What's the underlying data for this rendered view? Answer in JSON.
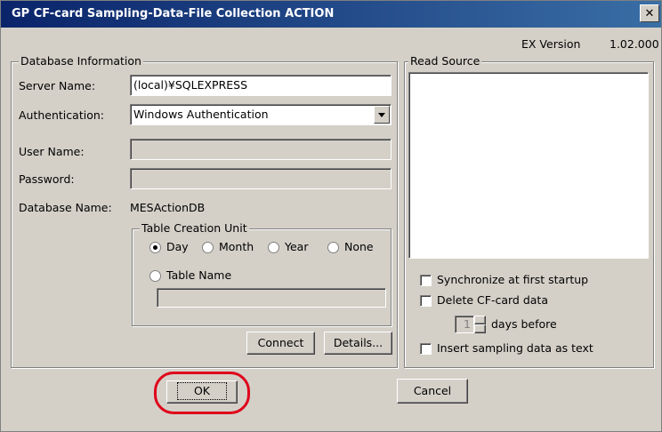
{
  "window": {
    "title": "GP CF-card Sampling-Data-File Collection ACTION",
    "close_label": "✕"
  },
  "version": {
    "label": "EX Version",
    "value": "1.02.000"
  },
  "db": {
    "legend": "Database Information",
    "server_label": "Server Name:",
    "server_value": "(local)¥SQLEXPRESS",
    "auth_label": "Authentication:",
    "auth_value": "Windows Authentication",
    "user_label": "User Name:",
    "user_value": "",
    "password_label": "Password:",
    "password_value": "",
    "dbname_label": "Database Name:",
    "dbname_value": "MESActionDB"
  },
  "table_unit": {
    "legend": "Table Creation Unit",
    "day": "Day",
    "month": "Month",
    "year": "Year",
    "none": "None",
    "table_name": "Table Name",
    "selected": "Day"
  },
  "buttons": {
    "connect": "Connect",
    "details": "Details...",
    "ok": "OK",
    "cancel": "Cancel"
  },
  "read_source": {
    "legend": "Read Source",
    "sync_label": "Synchronize at first startup",
    "delete_label": "Delete CF-card data",
    "days_value": "1",
    "days_label": "days before",
    "insert_label": "Insert sampling data as text"
  },
  "colors": {
    "title_start": "#0a246a",
    "title_end": "#3a6ea5",
    "highlight": "#e0001a"
  }
}
